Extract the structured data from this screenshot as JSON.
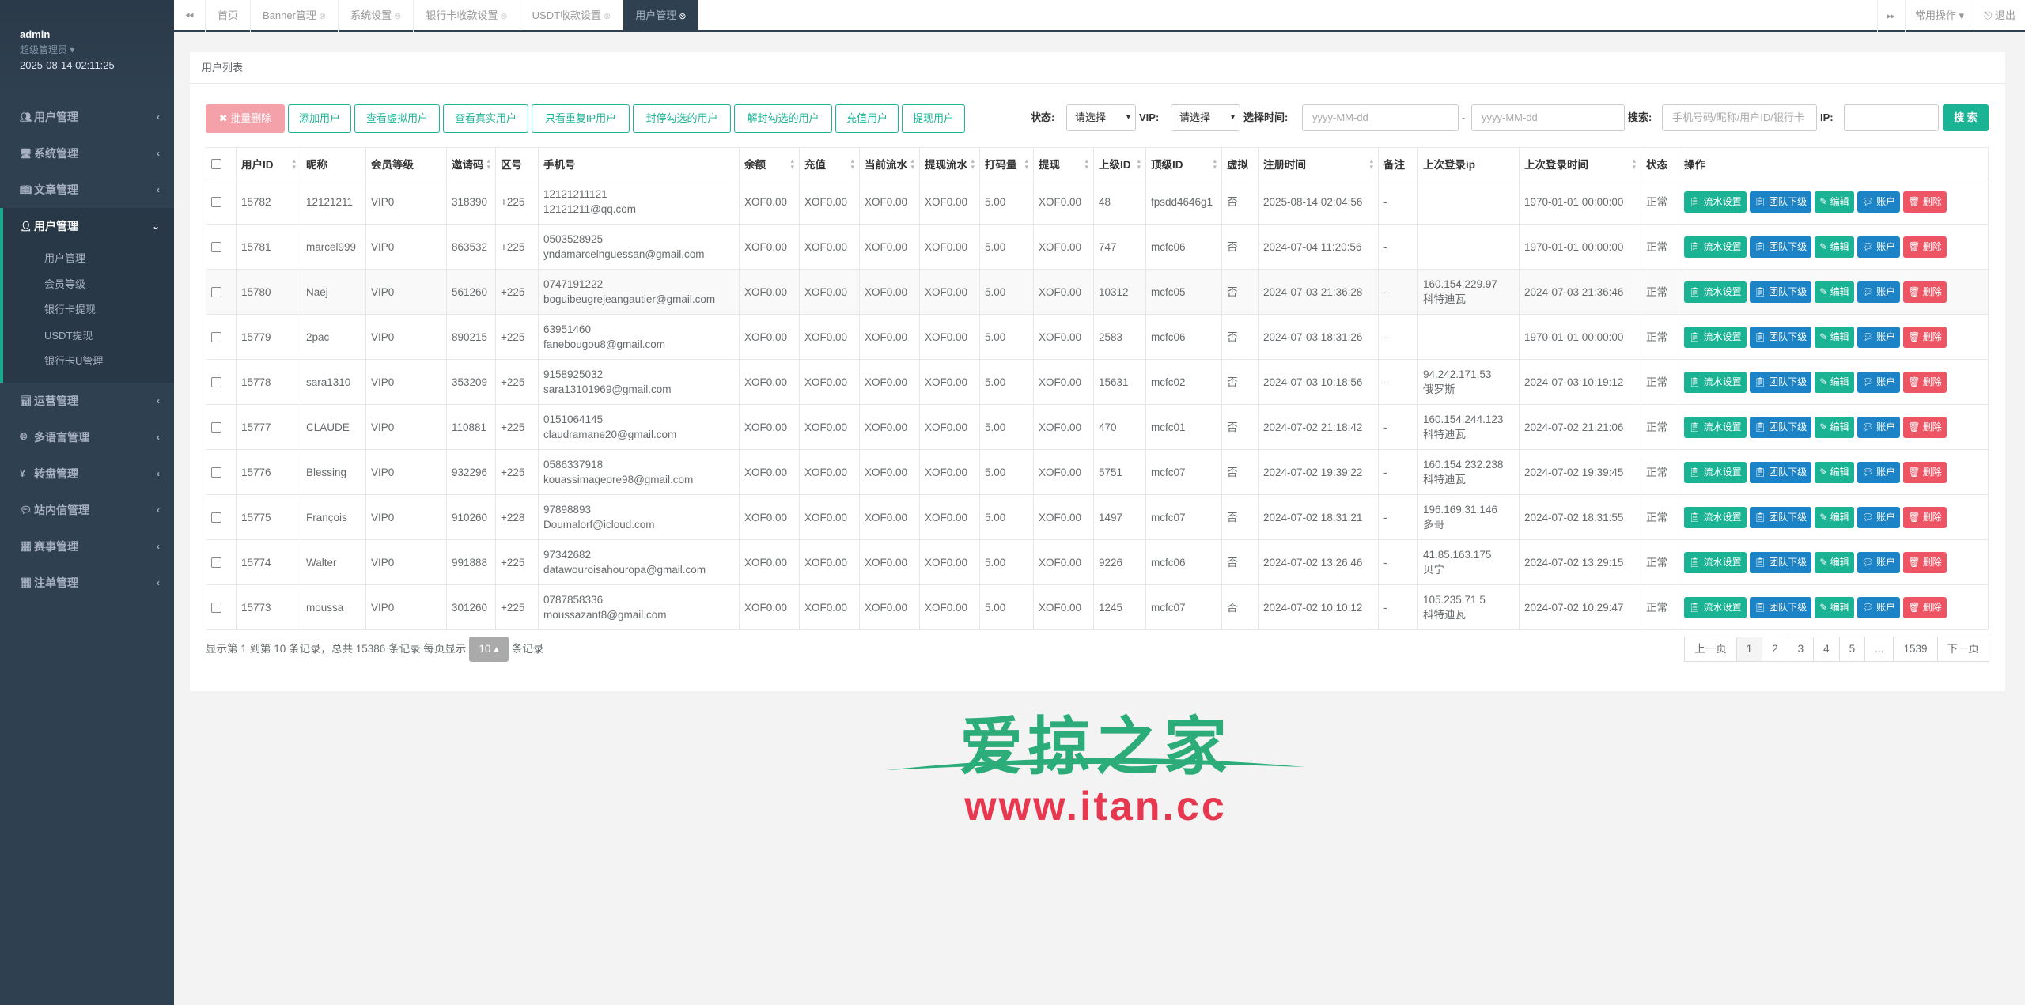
{
  "sidebar": {
    "user": "admin",
    "role": "超级管理员 ▾",
    "datetime": "2025-08-14 02:11:25",
    "menu": [
      {
        "label": "用户管理"
      },
      {
        "label": "系统管理"
      },
      {
        "label": "文章管理"
      },
      {
        "label": "用户管理"
      },
      {
        "label": "运营管理"
      },
      {
        "label": "多语言管理"
      },
      {
        "label": "转盘管理"
      },
      {
        "label": "站内信管理"
      },
      {
        "label": "赛事管理"
      },
      {
        "label": "注单管理"
      }
    ],
    "submenu": [
      "用户管理",
      "会员等级",
      "银行卡提现",
      "USDT提现",
      "银行卡U管理"
    ]
  },
  "topbar": {
    "tabs": [
      "首页",
      "Banner管理",
      "系统设置",
      "银行卡收款设置",
      "USDT收款设置",
      "用户管理"
    ],
    "common_ops": "常用操作 ▾",
    "logout": "退出"
  },
  "panel": {
    "title": "用户列表"
  },
  "toolbar": {
    "buttons": [
      "批量删除",
      "添加用户",
      "查看虚拟用户",
      "查看真实用户",
      "只看重复IP用户",
      "封停勾选的用户",
      "解封勾选的用户",
      "充值用户",
      "提现用户"
    ],
    "status_label": "状态:",
    "status_value": "请选择",
    "vip_label": "VIP:",
    "vip_value": "请选择",
    "time_label": "选择时间:",
    "date_placeholder_start": "yyyy-MM-dd",
    "date_sep": "-",
    "date_placeholder_end": "yyyy-MM-dd",
    "search_label": "搜索:",
    "search_placeholder": "手机号码/昵称/用户ID/银行卡",
    "ip_label": "IP:",
    "search_button": "搜 索"
  },
  "table": {
    "headers": [
      "用户ID",
      "昵称",
      "会员等级",
      "邀请码",
      "区号",
      "手机号",
      "余额",
      "充值",
      "当前流水",
      "提现流水",
      "打码量",
      "提现",
      "上级ID",
      "顶级ID",
      "虚拟",
      "注册时间",
      "备注",
      "上次登录ip",
      "上次登录时间",
      "状态",
      "操作"
    ],
    "ops": [
      "流水设置",
      "团队下级",
      "编辑",
      "账户",
      "删除"
    ],
    "rows": [
      {
        "id": "15782",
        "nick": "12121211",
        "level": "VIP0",
        "invite": "318390",
        "area": "+225",
        "phone": "12121211121",
        "email": "12121211@qq.com",
        "balance": "XOF0.00",
        "recharge": "XOF0.00",
        "flow": "XOF0.00",
        "wflow": "XOF0.00",
        "code": "5.00",
        "withdraw": "XOF0.00",
        "parent": "48",
        "top": "fpsdd4646g1",
        "virtual": "否",
        "reg": "2025-08-14 02:04:56",
        "note": "-",
        "ip": "",
        "ip_loc": "",
        "last": "1970-01-01 00:00:00",
        "status": "正常"
      },
      {
        "id": "15781",
        "nick": "marcel999",
        "level": "VIP0",
        "invite": "863532",
        "area": "+225",
        "phone": "0503528925",
        "email": "yndamarcelnguessan@gmail.com",
        "balance": "XOF0.00",
        "recharge": "XOF0.00",
        "flow": "XOF0.00",
        "wflow": "XOF0.00",
        "code": "5.00",
        "withdraw": "XOF0.00",
        "parent": "747",
        "top": "mcfc06",
        "virtual": "否",
        "reg": "2024-07-04 11:20:56",
        "note": "-",
        "ip": "",
        "ip_loc": "",
        "last": "1970-01-01 00:00:00",
        "status": "正常"
      },
      {
        "id": "15780",
        "nick": "Naej",
        "level": "VIP0",
        "invite": "561260",
        "area": "+225",
        "phone": "0747191222",
        "email": "boguibeugrejeangautier@gmail.com",
        "balance": "XOF0.00",
        "recharge": "XOF0.00",
        "flow": "XOF0.00",
        "wflow": "XOF0.00",
        "code": "5.00",
        "withdraw": "XOF0.00",
        "parent": "10312",
        "top": "mcfc05",
        "virtual": "否",
        "reg": "2024-07-03 21:36:28",
        "note": "-",
        "ip": "160.154.229.97",
        "ip_loc": "科特迪瓦",
        "last": "2024-07-03 21:36:46",
        "status": "正常"
      },
      {
        "id": "15779",
        "nick": "2pac",
        "level": "VIP0",
        "invite": "890215",
        "area": "+225",
        "phone": "63951460",
        "email": "fanebougou8@gmail.com",
        "balance": "XOF0.00",
        "recharge": "XOF0.00",
        "flow": "XOF0.00",
        "wflow": "XOF0.00",
        "code": "5.00",
        "withdraw": "XOF0.00",
        "parent": "2583",
        "top": "mcfc06",
        "virtual": "否",
        "reg": "2024-07-03 18:31:26",
        "note": "-",
        "ip": "",
        "ip_loc": "",
        "last": "1970-01-01 00:00:00",
        "status": "正常"
      },
      {
        "id": "15778",
        "nick": "sara1310",
        "level": "VIP0",
        "invite": "353209",
        "area": "+225",
        "phone": "9158925032",
        "email": "sara13101969@gmail.com",
        "balance": "XOF0.00",
        "recharge": "XOF0.00",
        "flow": "XOF0.00",
        "wflow": "XOF0.00",
        "code": "5.00",
        "withdraw": "XOF0.00",
        "parent": "15631",
        "top": "mcfc02",
        "virtual": "否",
        "reg": "2024-07-03 10:18:56",
        "note": "-",
        "ip": "94.242.171.53",
        "ip_loc": "俄罗斯",
        "last": "2024-07-03 10:19:12",
        "status": "正常"
      },
      {
        "id": "15777",
        "nick": "CLAUDE",
        "level": "VIP0",
        "invite": "110881",
        "area": "+225",
        "phone": "0151064145",
        "email": "claudramane20@gmail.com",
        "balance": "XOF0.00",
        "recharge": "XOF0.00",
        "flow": "XOF0.00",
        "wflow": "XOF0.00",
        "code": "5.00",
        "withdraw": "XOF0.00",
        "parent": "470",
        "top": "mcfc01",
        "virtual": "否",
        "reg": "2024-07-02 21:18:42",
        "note": "-",
        "ip": "160.154.244.123",
        "ip_loc": "科特迪瓦",
        "last": "2024-07-02 21:21:06",
        "status": "正常"
      },
      {
        "id": "15776",
        "nick": "Blessing",
        "level": "VIP0",
        "invite": "932296",
        "area": "+225",
        "phone": "0586337918",
        "email": "kouassimageore98@gmail.com",
        "balance": "XOF0.00",
        "recharge": "XOF0.00",
        "flow": "XOF0.00",
        "wflow": "XOF0.00",
        "code": "5.00",
        "withdraw": "XOF0.00",
        "parent": "5751",
        "top": "mcfc07",
        "virtual": "否",
        "reg": "2024-07-02 19:39:22",
        "note": "-",
        "ip": "160.154.232.238",
        "ip_loc": "科特迪瓦",
        "last": "2024-07-02 19:39:45",
        "status": "正常"
      },
      {
        "id": "15775",
        "nick": "François",
        "level": "VIP0",
        "invite": "910260",
        "area": "+228",
        "phone": "97898893",
        "email": "Doumalorf@icloud.com",
        "balance": "XOF0.00",
        "recharge": "XOF0.00",
        "flow": "XOF0.00",
        "wflow": "XOF0.00",
        "code": "5.00",
        "withdraw": "XOF0.00",
        "parent": "1497",
        "top": "mcfc07",
        "virtual": "否",
        "reg": "2024-07-02 18:31:21",
        "note": "-",
        "ip": "196.169.31.146",
        "ip_loc": "多哥",
        "last": "2024-07-02 18:31:55",
        "status": "正常"
      },
      {
        "id": "15774",
        "nick": "Walter",
        "level": "VIP0",
        "invite": "991888",
        "area": "+225",
        "phone": "97342682",
        "email": "datawouroisahouropa@gmail.com",
        "balance": "XOF0.00",
        "recharge": "XOF0.00",
        "flow": "XOF0.00",
        "wflow": "XOF0.00",
        "code": "5.00",
        "withdraw": "XOF0.00",
        "parent": "9226",
        "top": "mcfc06",
        "virtual": "否",
        "reg": "2024-07-02 13:26:46",
        "note": "-",
        "ip": "41.85.163.175",
        "ip_loc": "贝宁",
        "last": "2024-07-02 13:29:15",
        "status": "正常"
      },
      {
        "id": "15773",
        "nick": "moussa",
        "level": "VIP0",
        "invite": "301260",
        "area": "+225",
        "phone": "0787858336",
        "email": "moussazant8@gmail.com",
        "balance": "XOF0.00",
        "recharge": "XOF0.00",
        "flow": "XOF0.00",
        "wflow": "XOF0.00",
        "code": "5.00",
        "withdraw": "XOF0.00",
        "parent": "1245",
        "top": "mcfc07",
        "virtual": "否",
        "reg": "2024-07-02 10:10:12",
        "note": "-",
        "ip": "105.235.71.5",
        "ip_loc": "科特迪瓦",
        "last": "2024-07-02 10:29:47",
        "status": "正常"
      }
    ]
  },
  "footer": {
    "summary_prefix": "显示第 1 到第 10 条记录，总共 15386 条记录  每页显示",
    "page_size": "10 ▴",
    "summary_suffix": "条记录",
    "pages": [
      "上一页",
      "1",
      "2",
      "3",
      "4",
      "5",
      "...",
      "1539",
      "下一页"
    ]
  },
  "watermark": {
    "cn": "爱掠之家",
    "url": "www.itan.cc"
  },
  "colors": {
    "primary": "#1ab394",
    "info": "#1c84c6",
    "danger": "#ed5565",
    "sidebar": "#2f4050"
  }
}
